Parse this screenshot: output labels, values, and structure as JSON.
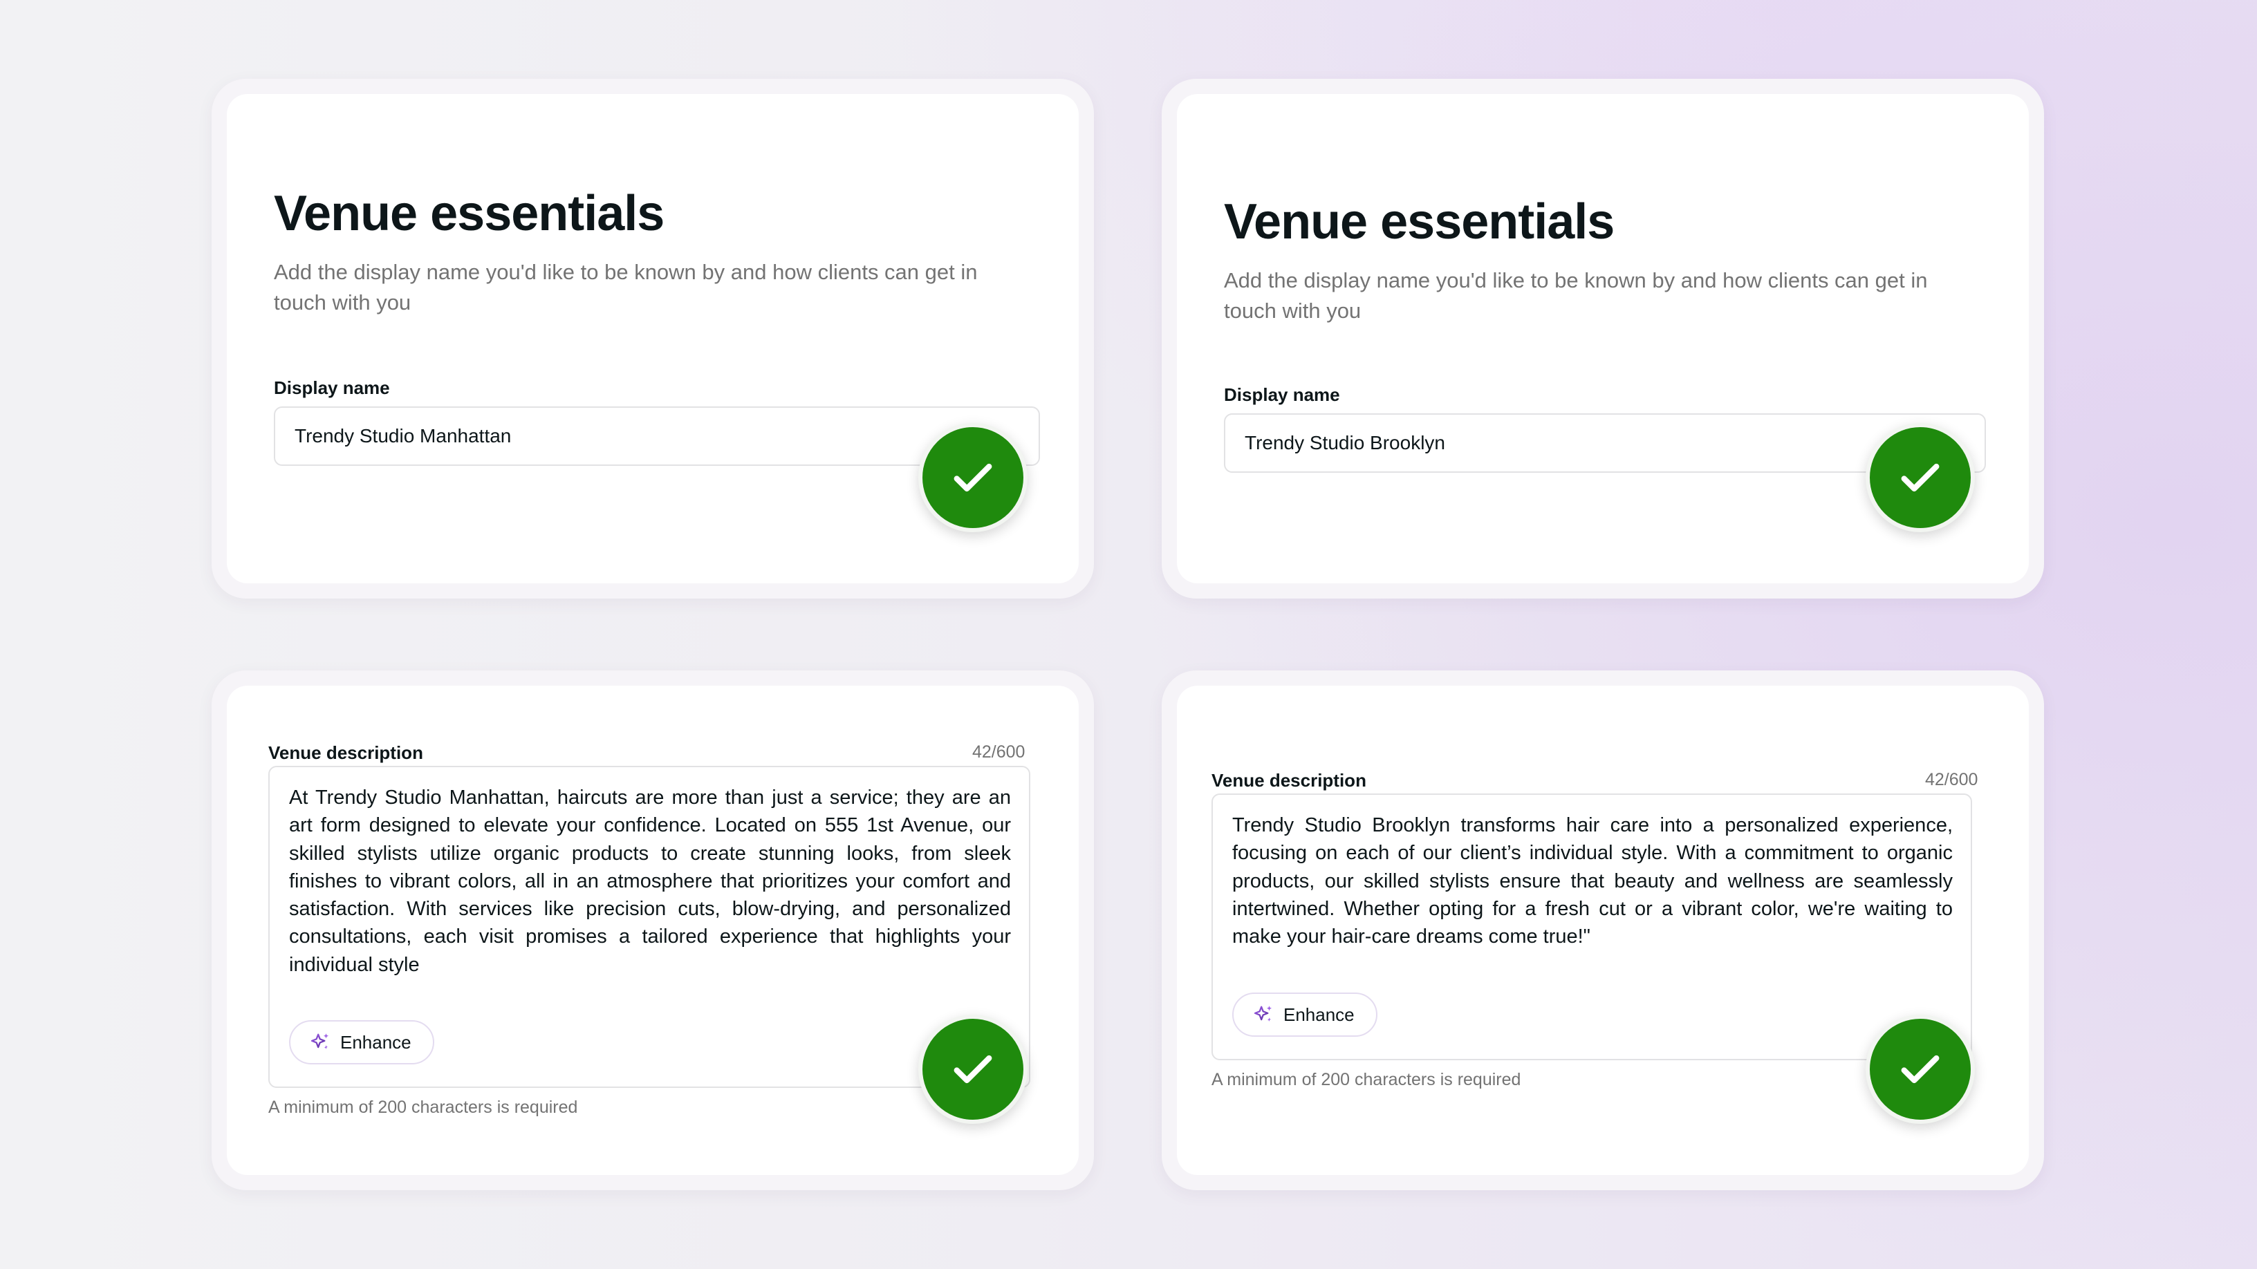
{
  "essentials_cards": [
    {
      "title": "Venue essentials",
      "subtitle": "Add the display name you'd like to be known by and how clients can get in touch with you",
      "display_name_label": "Display name",
      "display_name_value": "Trendy Studio Manhattan"
    },
    {
      "title": "Venue essentials",
      "subtitle": "Add the display name you'd like to be known by and how clients can get in touch with you",
      "display_name_label": "Display name",
      "display_name_value": "Trendy Studio Brooklyn"
    }
  ],
  "description_cards": [
    {
      "label": "Venue description",
      "counter": "42/600",
      "text": "At Trendy Studio Manhattan, haircuts are more than just a service; they are an art form designed to elevate your confidence. Located on 555 1st Avenue, our skilled stylists utilize organic products to create stunning looks, from sleek finishes to vibrant colors, all in an atmosphere that prioritizes your comfort and satisfaction. With services like precision cuts, blow-drying, and personalized consultations, each visit promises a tailored experience that highlights your individual style",
      "enhance_label": "Enhance",
      "hint": "A minimum of 200 characters is required"
    },
    {
      "label": "Venue description",
      "counter": "42/600",
      "text": "Trendy Studio Brooklyn transforms hair care into a personalized experience, focusing on each of our client’s individual style. With a commitment to organic products, our skilled stylists ensure that beauty and wellness are seamlessly intertwined. Whether opting for a fresh cut or a vibrant color, we're waiting to make your hair-care dreams come true!\"",
      "enhance_label": "Enhance",
      "hint": "A minimum of 200 characters is required"
    }
  ],
  "icons": {
    "check": "check-icon",
    "enhance": "sparkle-icon"
  },
  "colors": {
    "success": "#1f8a0d",
    "accent": "#7b3fc4",
    "text": "#0d1619",
    "muted": "#737373"
  }
}
